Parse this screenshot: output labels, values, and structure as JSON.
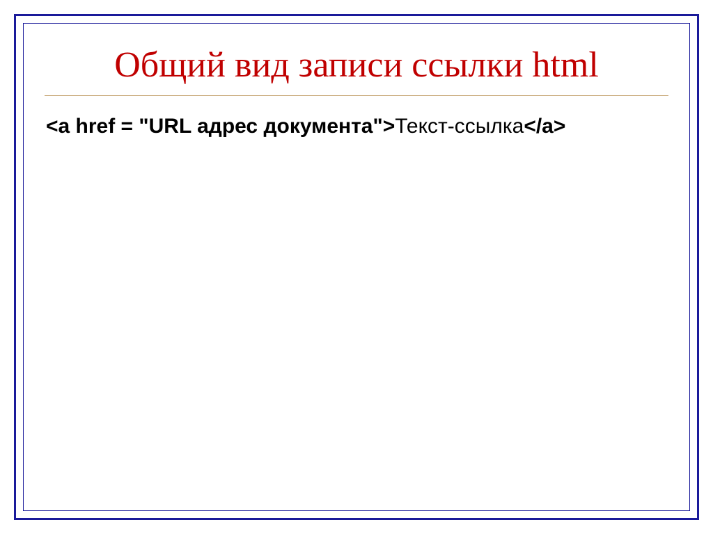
{
  "slide": {
    "title": "Общий вид записи ссылки html",
    "code": {
      "open1": "<a href = \"",
      "urlLabel": "URL адрес документа",
      "open2": "\">",
      "linkText": "Текст-ссылка",
      "close": "</a>"
    }
  }
}
